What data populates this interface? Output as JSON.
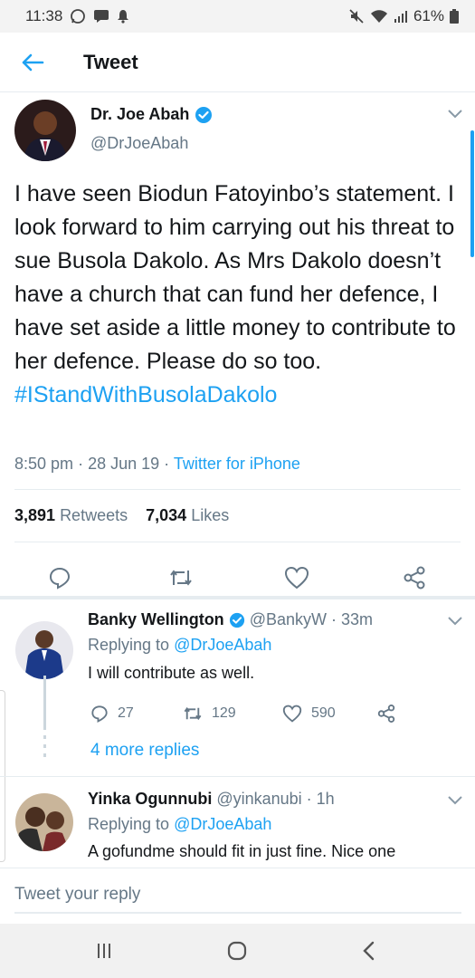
{
  "status_bar": {
    "time": "11:38",
    "battery": "61%"
  },
  "header": {
    "title": "Tweet"
  },
  "tweet": {
    "author_name": "Dr. Joe Abah",
    "handle": "@DrJoeAbah",
    "text": "I have seen Biodun Fatoyinbo’s statement. I look forward to him carrying out his threat to sue Busola Dakolo. As Mrs Dakolo doesn’t have a church that can fund her defence, I have set aside a little money to contribute to her defence. Please do so too. ",
    "hashtag": "#IStandWithBusolaDakolo",
    "time": "8:50 pm",
    "date": "28 Jun 19",
    "source": "Twitter for iPhone",
    "retweets_count": "3,891",
    "retweets_label": "Retweets",
    "likes_count": "7,034",
    "likes_label": "Likes"
  },
  "replies": [
    {
      "name": "Banky Wellington",
      "handle": "@BankyW",
      "age": "· 33m",
      "replying_label": "Replying to",
      "replying_to": "@DrJoeAbah",
      "text": "I will contribute as well.",
      "reply_count": "27",
      "retweet_count": "129",
      "like_count": "590",
      "more_replies": "4 more replies"
    },
    {
      "name": "Yinka Ogunnubi",
      "handle": "@yinkanubi",
      "age": "· 1h",
      "replying_label": "Replying to",
      "replying_to": "@DrJoeAbah",
      "text": "A gofundme should fit in just fine. Nice one"
    }
  ],
  "compose": {
    "placeholder": "Tweet your reply"
  },
  "colors": {
    "accent": "#1da1f2",
    "secondary_text": "#657786",
    "divider": "#e6ecf0"
  }
}
